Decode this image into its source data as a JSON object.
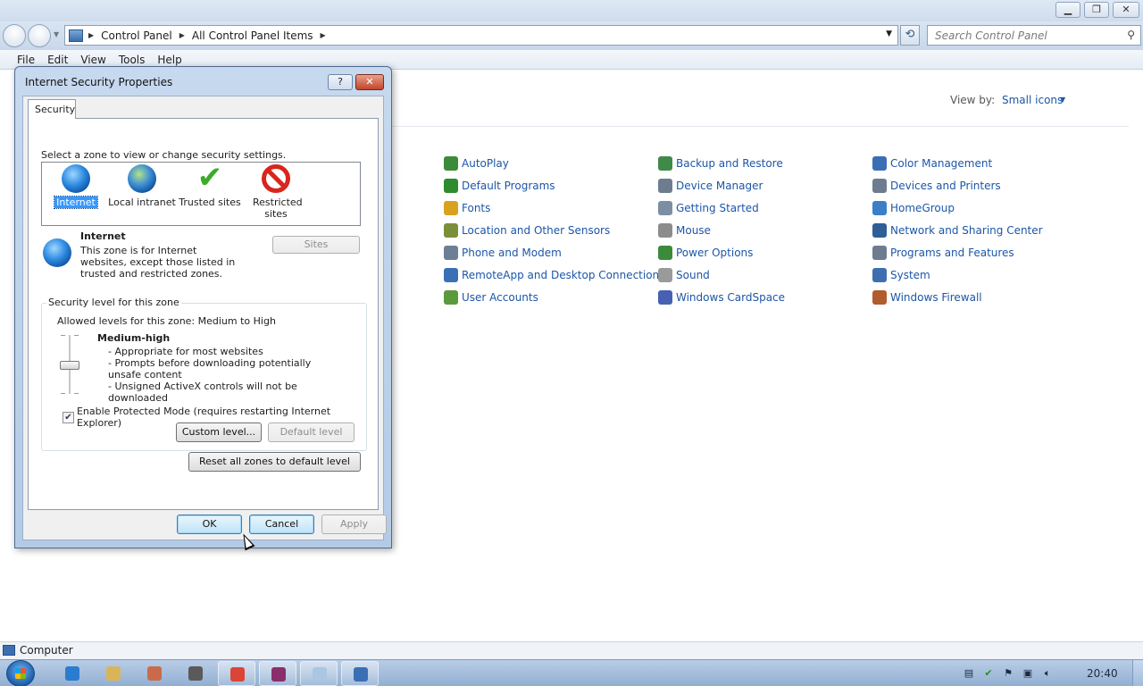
{
  "explorer": {
    "breadcrumb": [
      "Control Panel",
      "All Control Panel Items"
    ],
    "search_placeholder": "Search Control Panel",
    "menu": [
      "File",
      "Edit",
      "View",
      "Tools",
      "Help"
    ],
    "view_by_label": "View by:",
    "view_by_value": "Small icons",
    "items": [
      {
        "label": "AutoPlay",
        "icon": "autoplay-icon",
        "color": "#3b8b3b"
      },
      {
        "label": "Default Programs",
        "icon": "default-programs-icon",
        "color": "#2e8b2e"
      },
      {
        "label": "Fonts",
        "icon": "fonts-icon",
        "color": "#d8a21f"
      },
      {
        "label": "Location and Other Sensors",
        "icon": "location-icon",
        "color": "#7b8f3a"
      },
      {
        "label": "Phone and Modem",
        "icon": "phone-icon",
        "color": "#6d7f95"
      },
      {
        "label": "RemoteApp and Desktop Connections",
        "icon": "remoteapp-icon",
        "color": "#3a6fb5"
      },
      {
        "label": "User Accounts",
        "icon": "user-accounts-icon",
        "color": "#5b9a3c"
      },
      {
        "label": "Backup and Restore",
        "icon": "backup-icon",
        "color": "#3e8a49"
      },
      {
        "label": "Device Manager",
        "icon": "device-manager-icon",
        "color": "#6d7d8f"
      },
      {
        "label": "Getting Started",
        "icon": "getting-started-icon",
        "color": "#7c8ea4"
      },
      {
        "label": "Mouse",
        "icon": "mouse-icon",
        "color": "#8c8c8c"
      },
      {
        "label": "Power Options",
        "icon": "power-icon",
        "color": "#3b8b3b"
      },
      {
        "label": "Sound",
        "icon": "sound-icon",
        "color": "#9a9a9a"
      },
      {
        "label": "Windows CardSpace",
        "icon": "cardspace-icon",
        "color": "#4661b3"
      },
      {
        "label": "Color Management",
        "icon": "color-management-icon",
        "color": "#3a6fb5"
      },
      {
        "label": "Devices and Printers",
        "icon": "devices-printers-icon",
        "color": "#6d7d8f"
      },
      {
        "label": "HomeGroup",
        "icon": "homegroup-icon",
        "color": "#3a7fc8"
      },
      {
        "label": "Network and Sharing Center",
        "icon": "network-icon",
        "color": "#2f5f96"
      },
      {
        "label": "Programs and Features",
        "icon": "programs-icon",
        "color": "#6d7d8f"
      },
      {
        "label": "System",
        "icon": "system-icon",
        "color": "#3d6fb0"
      },
      {
        "label": "Windows Firewall",
        "icon": "firewall-icon",
        "color": "#b25b2b"
      }
    ],
    "status": "Computer"
  },
  "dialog": {
    "title": "Internet Security Properties",
    "help_glyph": "?",
    "close_glyph": "✕",
    "tab": "Security",
    "zone_prompt": "Select a zone to view or change security settings.",
    "zones": [
      {
        "label": "Internet",
        "selected": true
      },
      {
        "label": "Local intranet",
        "selected": false
      },
      {
        "label": "Trusted sites",
        "selected": false
      },
      {
        "label": "Restricted sites",
        "selected": false
      }
    ],
    "zone_title": "Internet",
    "zone_description": "This zone is for Internet websites, except those listed in trusted and restricted zones.",
    "sites_button": "Sites",
    "security_level_legend": "Security level for this zone",
    "allowed_levels": "Allowed levels for this zone: Medium to High",
    "level_name": "Medium-high",
    "level_details": [
      "- Appropriate for most websites",
      "- Prompts before downloading potentially unsafe content",
      "- Unsigned ActiveX controls will not be downloaded"
    ],
    "slider_level_fraction": 0.5,
    "protected_mode_label": "Enable Protected Mode (requires restarting Internet Explorer)",
    "protected_mode_checked": true,
    "custom_level_button": "Custom level...",
    "default_level_button": "Default level",
    "reset_button": "Reset all zones to default level",
    "ok_button": "OK",
    "cancel_button": "Cancel",
    "apply_button": "Apply"
  },
  "taskbar": {
    "clock": "20:40",
    "apps": [
      {
        "name": "ie-icon",
        "color": "#2a7ccf"
      },
      {
        "name": "explorer-icon",
        "color": "#d9b45a"
      },
      {
        "name": "paint-icon",
        "color": "#c96b4a"
      },
      {
        "name": "raccoon-icon",
        "color": "#5a5a5a"
      },
      {
        "name": "chrome-icon",
        "color": "#db4437"
      },
      {
        "name": "winrar-icon",
        "color": "#8a2f6b"
      },
      {
        "name": "notepad-icon",
        "color": "#a9c6e3"
      },
      {
        "name": "control-panel-icon",
        "color": "#3a6fb5"
      }
    ]
  }
}
